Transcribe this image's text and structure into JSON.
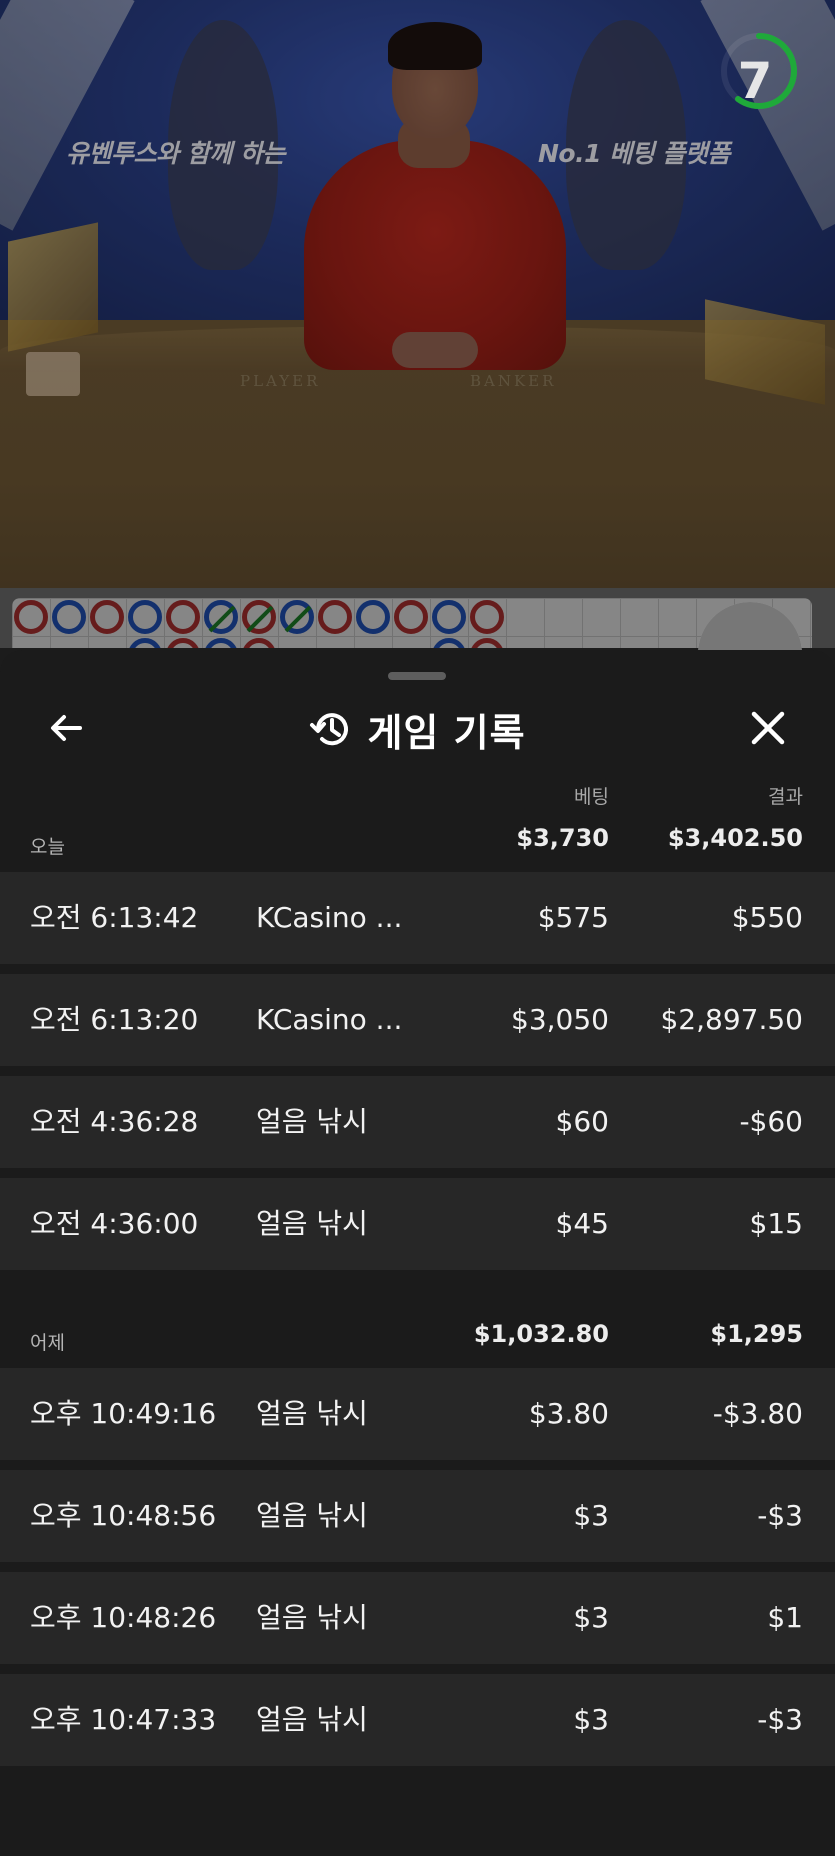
{
  "video": {
    "banner_left": "유벤투스와 함께 하는",
    "banner_right": "No.1 베팅 플랫폼",
    "felt_player": "PLAYER",
    "felt_banker": "BANKER",
    "timer_value": "7",
    "timer_color": "#1fa93a"
  },
  "road": {
    "row1": [
      "P",
      "B",
      "P",
      "B",
      "P",
      "T",
      "T",
      "T",
      "P",
      "B",
      "P",
      "B",
      "P"
    ],
    "colors": {
      "player": "#b33333",
      "banker": "#2458c7",
      "tie": "#1f8a2c"
    }
  },
  "sheet": {
    "title": "게임 기록",
    "icons": {
      "back": "back-arrow-icon",
      "history": "history-icon",
      "close": "close-icon"
    },
    "columns": {
      "bet": "베팅",
      "result": "결과"
    },
    "sections": [
      {
        "label": "오늘",
        "bet_total": "$3,730",
        "result_total": "$3,402.50",
        "rows": [
          {
            "time": "오전 6:13:42",
            "game": "KCasino ...",
            "bet": "$575",
            "result": "$550"
          },
          {
            "time": "오전 6:13:20",
            "game": "KCasino ...",
            "bet": "$3,050",
            "result": "$2,897.50"
          },
          {
            "time": "오전 4:36:28",
            "game": "얼음 낚시",
            "bet": "$60",
            "result": "-$60"
          },
          {
            "time": "오전 4:36:00",
            "game": "얼음 낚시",
            "bet": "$45",
            "result": "$15"
          }
        ]
      },
      {
        "label": "어제",
        "bet_total": "$1,032.80",
        "result_total": "$1,295",
        "rows": [
          {
            "time": "오후 10:49:16",
            "game": "얼음 낚시",
            "bet": "$3.80",
            "result": "-$3.80"
          },
          {
            "time": "오후 10:48:56",
            "game": "얼음 낚시",
            "bet": "$3",
            "result": "-$3"
          },
          {
            "time": "오후 10:48:26",
            "game": "얼음 낚시",
            "bet": "$3",
            "result": "$1"
          },
          {
            "time": "오후 10:47:33",
            "game": "얼음 낚시",
            "bet": "$3",
            "result": "-$3"
          }
        ]
      }
    ]
  }
}
